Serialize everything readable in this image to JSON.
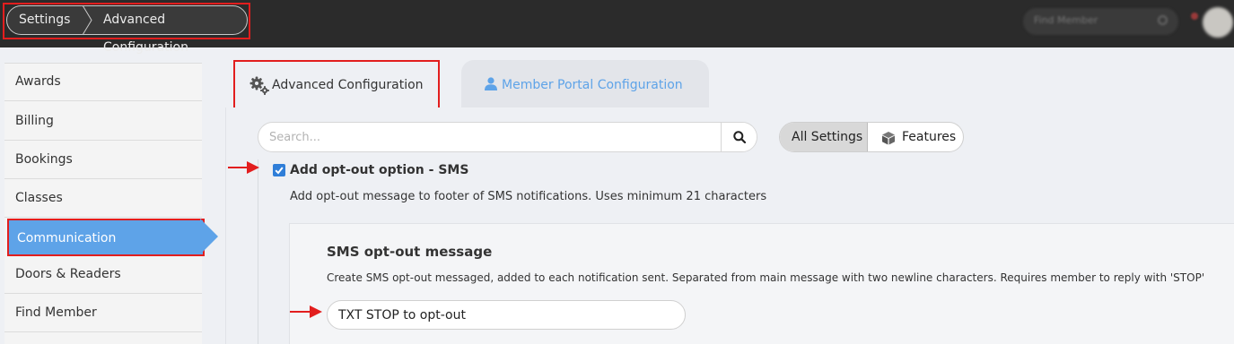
{
  "breadcrumb": {
    "items": [
      "Settings",
      "Advanced Configuration"
    ]
  },
  "top_search": {
    "placeholder": "Find Member"
  },
  "sidebar": {
    "items": [
      {
        "label": "Awards"
      },
      {
        "label": "Billing"
      },
      {
        "label": "Bookings"
      },
      {
        "label": "Classes"
      },
      {
        "label": "Communication",
        "active": true
      },
      {
        "label": "Doors & Readers"
      },
      {
        "label": "Find Member"
      }
    ]
  },
  "tabs": [
    {
      "label": "Advanced Configuration",
      "icon": "gears-icon",
      "active": true
    },
    {
      "label": "Member Portal Configuration",
      "icon": "user-icon",
      "active": false
    }
  ],
  "search": {
    "placeholder": "Search...",
    "value": ""
  },
  "filter": {
    "all_label": "All Settings",
    "features_label": "Features",
    "selected": "All Settings"
  },
  "option": {
    "checked": true,
    "title": "Add opt-out option - SMS",
    "description": "Add opt-out message to footer of SMS notifications. Uses minimum 21 characters"
  },
  "sub_setting": {
    "title": "SMS opt-out message",
    "description": "Create SMS opt-out messaged, added to each notification sent. Separated from main message with two newline characters. Requires member to reply with 'STOP'",
    "value": "TXT STOP to opt-out"
  },
  "colors": {
    "accent": "#5ea3e8",
    "checkbox": "#2f7ed8",
    "annotation": "#e21e1e",
    "topbar": "#2b2b2b"
  }
}
